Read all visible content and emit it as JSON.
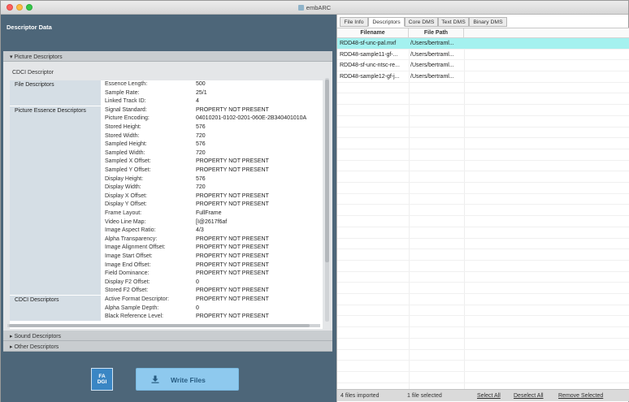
{
  "window": {
    "title": "embARC"
  },
  "left": {
    "header": "Descriptor Data",
    "picture_descriptors_label": "▾ Picture Descriptors",
    "cdci_title": "CDCI Descriptor",
    "sections": [
      {
        "label": "File Descriptors"
      },
      {
        "label": "Picture Essence Descriptors"
      },
      {
        "label": "CDCI Descriptors"
      }
    ],
    "rows": [
      {
        "k": "Essence Length:",
        "v": "500"
      },
      {
        "k": "Sample Rate:",
        "v": "25/1"
      },
      {
        "k": "Linked Track ID:",
        "v": "4"
      },
      {
        "k": "Signal Standard:",
        "v": "PROPERTY NOT PRESENT"
      },
      {
        "k": "Picture Encoding:",
        "v": "04010201-0102-0201-060E-2B340401010A"
      },
      {
        "k": "Stored Height:",
        "v": "576"
      },
      {
        "k": "Stored Width:",
        "v": "720"
      },
      {
        "k": "Sampled Height:",
        "v": "576"
      },
      {
        "k": "Sampled Width:",
        "v": "720"
      },
      {
        "k": "Sampled X Offset:",
        "v": "PROPERTY NOT PRESENT"
      },
      {
        "k": "Sampled Y Offset:",
        "v": "PROPERTY NOT PRESENT"
      },
      {
        "k": "Display Height:",
        "v": "576"
      },
      {
        "k": "Display Width:",
        "v": "720"
      },
      {
        "k": "Display X Offset:",
        "v": "PROPERTY NOT PRESENT"
      },
      {
        "k": "Display Y Offset:",
        "v": "PROPERTY NOT PRESENT"
      },
      {
        "k": "Frame Layout:",
        "v": "FullFrame"
      },
      {
        "k": "Video Line Map:",
        "v": "[I@2617f6af"
      },
      {
        "k": "Image Aspect Ratio:",
        "v": "4/3"
      },
      {
        "k": "Alpha Transparency:",
        "v": "PROPERTY NOT PRESENT"
      },
      {
        "k": "Image Alignment Offset:",
        "v": "PROPERTY NOT PRESENT"
      },
      {
        "k": "Image Start Offset:",
        "v": "PROPERTY NOT PRESENT"
      },
      {
        "k": "Image End Offset:",
        "v": "PROPERTY NOT PRESENT"
      },
      {
        "k": "Field Dominance:",
        "v": "PROPERTY NOT PRESENT"
      },
      {
        "k": "Display F2 Offset:",
        "v": "0"
      },
      {
        "k": "Stored F2 Offset:",
        "v": "PROPERTY NOT PRESENT"
      },
      {
        "k": "Active Format Descriptor:",
        "v": "PROPERTY NOT PRESENT"
      },
      {
        "k": "Alpha Sample Depth:",
        "v": "0"
      },
      {
        "k": "Black Reference Level:",
        "v": "PROPERTY NOT PRESENT"
      }
    ],
    "sound_descriptors_label": "▸ Sound Descriptors",
    "other_descriptors_label": "▸ Other Descriptors",
    "logo_line1": "FA",
    "logo_line2": "DGI",
    "write_button_label": "Write Files"
  },
  "right": {
    "tabs": [
      {
        "label": "File Info"
      },
      {
        "label": "Descriptors"
      },
      {
        "label": "Core DMS"
      },
      {
        "label": "Text DMS"
      },
      {
        "label": "Binary DMS"
      }
    ],
    "columns": [
      "Filename",
      "File Path"
    ],
    "files": [
      {
        "name": "RDD48-sf-unc-pal.mxf",
        "path": "/Users/bertraml..."
      },
      {
        "name": "RDD48-sample11-gf-...",
        "path": "/Users/bertraml..."
      },
      {
        "name": "RDD48-sf-unc-ntsc-re...",
        "path": "/Users/bertraml..."
      },
      {
        "name": "RDD48-sample12-gf-j...",
        "path": "/Users/bertraml..."
      }
    ],
    "status": {
      "imported": "4 files imported",
      "selected": "1 file selected",
      "select_all": "Select All",
      "deselect_all": "Deselect All",
      "remove_selected": "Remove Selected"
    }
  },
  "colors": {
    "left_panel": "#4d6679",
    "selected_row": "#a4f1ef",
    "write_button": "#8ec9ee",
    "section_label_bg": "#d5dee5"
  }
}
